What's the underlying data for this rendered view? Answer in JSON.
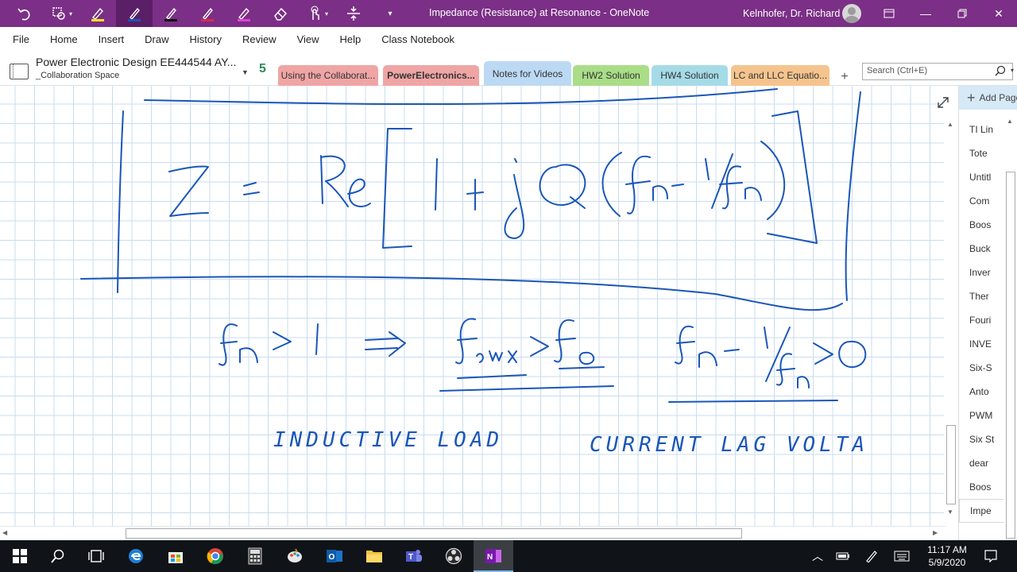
{
  "window": {
    "title": "Impedance (Resistance) at Resonance  -  OneNote",
    "user": "Kelnhofer, Dr. Richard"
  },
  "quick_access": {
    "tools": [
      {
        "name": "undo-icon"
      },
      {
        "name": "lasso-select-icon"
      },
      {
        "name": "highlighter-yellow-icon",
        "color": "#f5e11c"
      },
      {
        "name": "pen-blue-icon",
        "color": "#1a56b8"
      },
      {
        "name": "pen-black-icon",
        "color": "#111111"
      },
      {
        "name": "pen-red-icon",
        "color": "#e0284e"
      },
      {
        "name": "highlighter-magenta-icon",
        "color": "#e040e0"
      },
      {
        "name": "eraser-icon"
      },
      {
        "name": "touch-draw-icon"
      },
      {
        "name": "insert-space-icon"
      },
      {
        "name": "customize-dropdown-icon"
      }
    ]
  },
  "menu": [
    "File",
    "Home",
    "Insert",
    "Draw",
    "History",
    "Review",
    "View",
    "Help",
    "Class Notebook"
  ],
  "notebook": {
    "title": "Power Electronic Design EE444544 AY...",
    "subtitle": "_Collaboration Space",
    "sync": "5"
  },
  "section_tabs": [
    {
      "label": "Using the Collaborat...",
      "color": "#f0a5a5",
      "bold": false,
      "active": false
    },
    {
      "label": "PowerElectronics...",
      "color": "#f0a5a5",
      "bold": true,
      "active": false
    },
    {
      "label": "Notes for Videos",
      "color": "#bcd9f4",
      "bold": false,
      "active": true
    },
    {
      "label": "HW2 Solution",
      "color": "#a9dd87",
      "bold": false,
      "active": false
    },
    {
      "label": "HW4 Solution",
      "color": "#a5dbe7",
      "bold": false,
      "active": false
    },
    {
      "label": "LC and LLC Equatio...",
      "color": "#f5c48e",
      "bold": false,
      "active": false
    }
  ],
  "search": {
    "placeholder": "Search (Ctrl+E)"
  },
  "ink_text": {
    "inductive_load": "INDUCTIVE  LOAD",
    "current_lag": "CURRENT   LAG VOLTA"
  },
  "pages": {
    "add_label": "Add Page",
    "items": [
      "TI Lin",
      "Tote",
      "Untitl",
      "Com",
      "Boos",
      "Buck",
      "Inver",
      "Ther",
      "Fouri",
      "INVE",
      "Six-S",
      "Anto",
      "PWM",
      "Six St",
      "dear",
      "Boos",
      "Impe"
    ],
    "active_index": 16
  },
  "taskbar": {
    "time": "11:17 AM",
    "date": "5/9/2020",
    "apps": [
      "windows-start-icon",
      "search-icon",
      "task-view-icon",
      "edge-icon",
      "store-icon",
      "chrome-icon",
      "calculator-icon",
      "paint-icon",
      "outlook-icon",
      "file-explorer-icon",
      "teams-icon",
      "obs-icon",
      "onenote-icon"
    ]
  },
  "colors": {
    "titlebar": "#7b2f86",
    "ink": "#1a56b8",
    "grid": "#c8dcef"
  }
}
